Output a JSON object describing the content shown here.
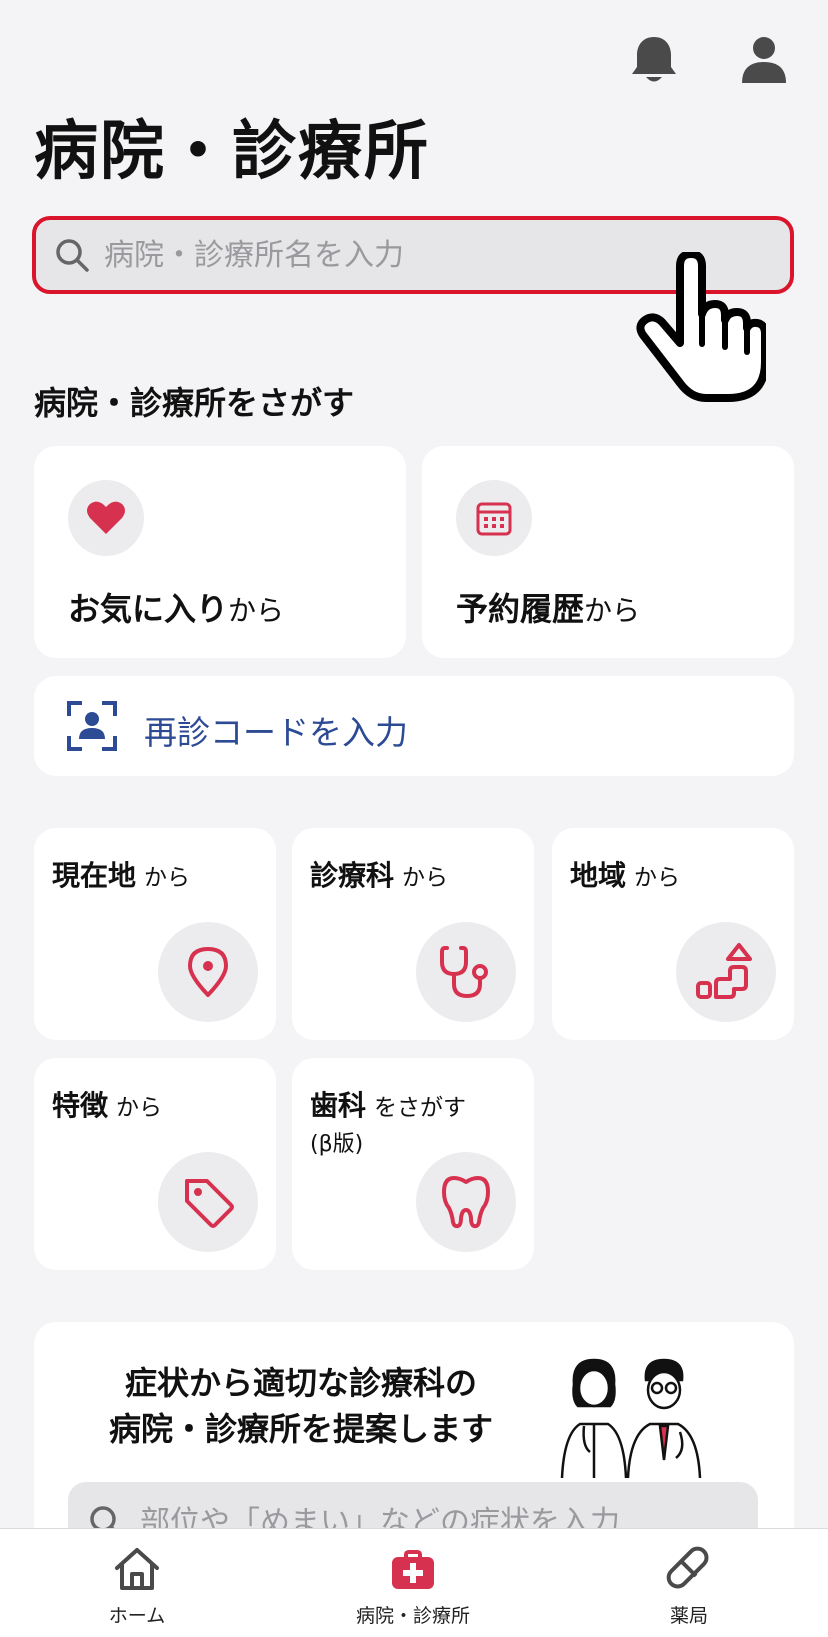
{
  "header": {
    "title": "病院・診療所",
    "bell_icon": "bell-icon",
    "account_icon": "person-icon"
  },
  "search": {
    "placeholder": "病院・診療所名を入力"
  },
  "section": {
    "heading": "病院・診療所をさがす"
  },
  "quick": [
    {
      "main": "お気に入り",
      "sub": "から",
      "icon": "heart-icon"
    },
    {
      "main": "予約履歴",
      "sub": "から",
      "icon": "calendar-icon"
    }
  ],
  "reentry": {
    "label": "再診コードを入力",
    "icon": "scan-person-icon"
  },
  "finders": [
    {
      "main": "現在地",
      "sub": "から",
      "icon": "location-pin-icon"
    },
    {
      "main": "診療科",
      "sub": "から",
      "icon": "stethoscope-icon"
    },
    {
      "main": "地域",
      "sub": "から",
      "icon": "map-blocks-icon"
    },
    {
      "main": "特徴",
      "sub": "から",
      "icon": "tag-icon"
    },
    {
      "main": "歯科",
      "sub": "をさがす",
      "note": "(β版)",
      "icon": "tooth-icon"
    }
  ],
  "promo": {
    "line1": "症状から適切な診療科の",
    "line2": "病院・診療所を提案します",
    "search_placeholder": "部位や「めまい」などの症状を入力"
  },
  "nav": {
    "home": "ホーム",
    "clinics": "病院・診療所",
    "pharmacy": "薬局"
  },
  "colors": {
    "accent": "#d9142b",
    "icon_red": "#d6324f",
    "link_blue": "#2d4a94",
    "background": "#f4f4f6"
  }
}
